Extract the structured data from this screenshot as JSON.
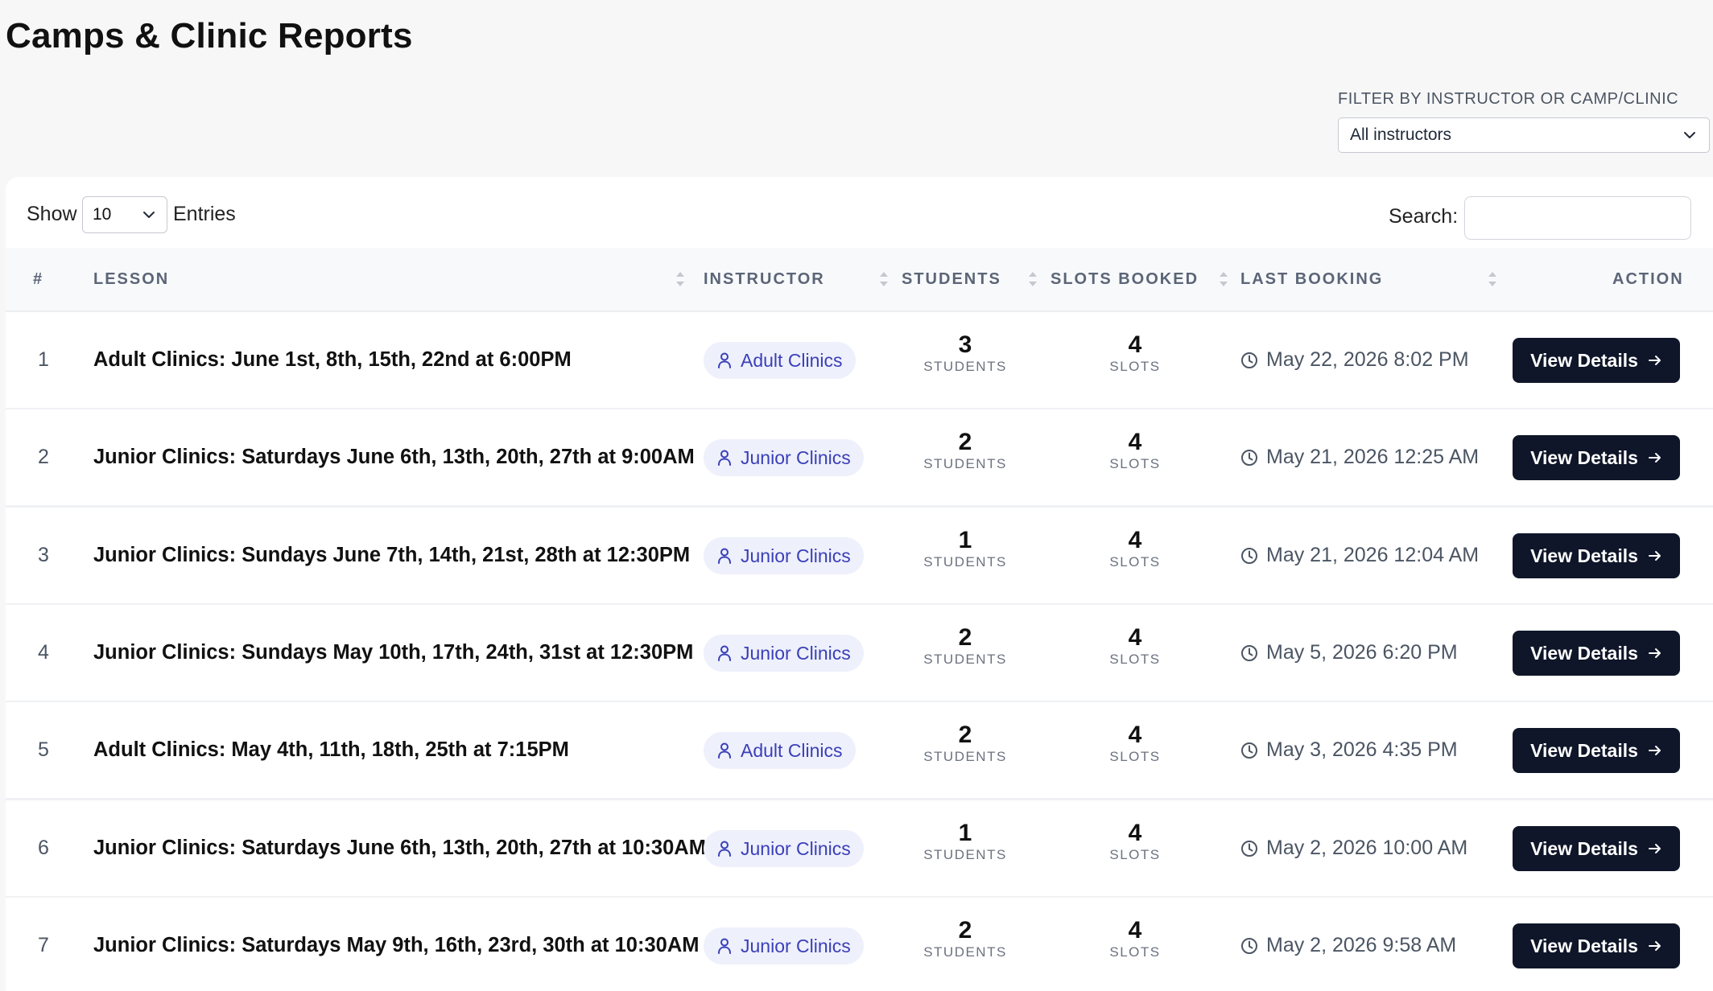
{
  "page": {
    "title": "Camps & Clinic Reports"
  },
  "filter": {
    "label": "FILTER BY INSTRUCTOR OR CAMP/CLINIC",
    "selected": "All instructors"
  },
  "table_controls": {
    "show_label": "Show",
    "entries_value": "10",
    "entries_label": "Entries",
    "search_label": "Search:",
    "search_value": ""
  },
  "columns": [
    "#",
    "LESSON",
    "INSTRUCTOR",
    "STUDENTS",
    "SLOTS BOOKED",
    "LAST BOOKING",
    "ACTION"
  ],
  "rows": [
    {
      "num": "1",
      "lesson": "Adult Clinics: June 1st, 8th, 15th, 22nd at 6:00PM",
      "instructor": "Adult Clinics",
      "students": "3",
      "students_unit": "STUDENTS",
      "slots": "4",
      "slots_unit": "SLOTS",
      "last_booking": "May 22, 2026 8:02 PM",
      "action": "View Details"
    },
    {
      "num": "2",
      "lesson": "Junior Clinics: Saturdays June 6th, 13th, 20th, 27th at 9:00AM",
      "instructor": "Junior Clinics",
      "students": "2",
      "students_unit": "STUDENTS",
      "slots": "4",
      "slots_unit": "SLOTS",
      "last_booking": "May 21, 2026 12:25 AM",
      "action": "View Details"
    },
    {
      "num": "3",
      "lesson": "Junior Clinics: Sundays June 7th, 14th, 21st, 28th at 12:30PM",
      "instructor": "Junior Clinics",
      "students": "1",
      "students_unit": "STUDENTS",
      "slots": "4",
      "slots_unit": "SLOTS",
      "last_booking": "May 21, 2026 12:04 AM",
      "action": "View Details"
    },
    {
      "num": "4",
      "lesson": "Junior Clinics: Sundays May 10th, 17th, 24th, 31st at 12:30PM",
      "instructor": "Junior Clinics",
      "students": "2",
      "students_unit": "STUDENTS",
      "slots": "4",
      "slots_unit": "SLOTS",
      "last_booking": "May 5, 2026 6:20 PM",
      "action": "View Details"
    },
    {
      "num": "5",
      "lesson": "Adult Clinics: May 4th, 11th, 18th, 25th at 7:15PM",
      "instructor": "Adult Clinics",
      "students": "2",
      "students_unit": "STUDENTS",
      "slots": "4",
      "slots_unit": "SLOTS",
      "last_booking": "May 3, 2026 4:35 PM",
      "action": "View Details"
    },
    {
      "num": "6",
      "lesson": "Junior Clinics: Saturdays June 6th, 13th, 20th, 27th at 10:30AM",
      "instructor": "Junior Clinics",
      "students": "1",
      "students_unit": "STUDENTS",
      "slots": "4",
      "slots_unit": "SLOTS",
      "last_booking": "May 2, 2026 10:00 AM",
      "action": "View Details"
    },
    {
      "num": "7",
      "lesson": "Junior Clinics: Saturdays May 9th, 16th, 23rd, 30th at 10:30AM",
      "instructor": "Junior Clinics",
      "students": "2",
      "students_unit": "STUDENTS",
      "slots": "4",
      "slots_unit": "SLOTS",
      "last_booking": "May 2, 2026 9:58 AM",
      "action": "View Details"
    }
  ],
  "icons": {
    "filter_dropdown": "chevron-down-icon",
    "entries_dropdown": "chevron-down-icon",
    "sort": "sort-icon",
    "instructor": "user-icon",
    "last_booking": "clock-icon",
    "action": "arrow-right-icon"
  },
  "colors": {
    "button_bg": "#0f1629",
    "badge_bg": "#eef0fb",
    "badge_text": "#3a3fb8"
  }
}
